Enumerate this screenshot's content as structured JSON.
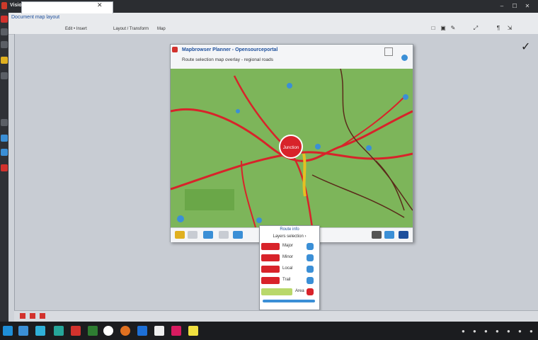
{
  "window": {
    "title": "Vision Analysis",
    "controls": [
      "–",
      "☐",
      "✕"
    ]
  },
  "ribbon": {
    "tab_label": "Document map layout",
    "items": [
      "Edit • Insert",
      "Layout / Transform",
      "Map"
    ],
    "right_icons": [
      "□",
      "▣",
      "✎",
      "⤢",
      "¶",
      "⇲"
    ]
  },
  "map_window": {
    "url": "Mapbrowser Planner - Opensourceportal",
    "subtitle": "Route selection map overlay - regional roads",
    "center_label": "Junction",
    "road_color": "#d8232a",
    "land_color": "#7db55a"
  },
  "popup": {
    "title": "Route info",
    "subtitle": "Layers selection ›",
    "rows": [
      {
        "label": "Major",
        "color": "#d8232a"
      },
      {
        "label": "Minor",
        "color": "#d8232a"
      },
      {
        "label": "Local",
        "color": "#d8232a"
      },
      {
        "label": "Trail",
        "color": "#d8232a"
      },
      {
        "label": "Area",
        "color": "#b9d86a"
      }
    ]
  },
  "taskbar": {
    "icons": [
      "start-icon",
      "browser-icon",
      "files-icon",
      "music-icon",
      "chrome-icon",
      "media-icon",
      "docs-icon",
      "game-icon",
      "notes-icon"
    ]
  }
}
